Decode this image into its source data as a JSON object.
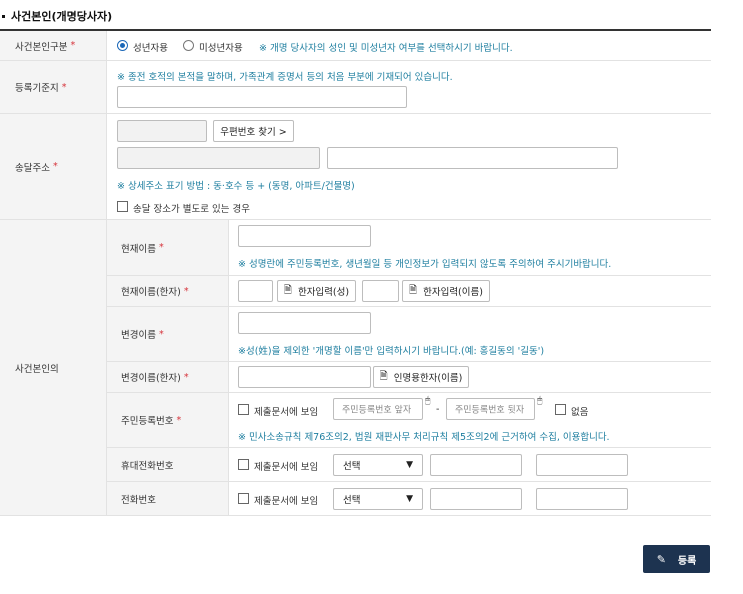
{
  "section": {
    "title": "사건본인(개명당사자)"
  },
  "required_mark": "*",
  "labels": {
    "category": "사건본인구분",
    "registry": "등록기준지",
    "address": "송달주소",
    "person": "사건본인의",
    "current_name": "현재이름",
    "current_name_hanja": "현재이름(한자)",
    "new_name": "변경이름",
    "new_name_hanja": "변경이름(한자)",
    "rrn": "주민등록번호",
    "mobile": "휴대전화번호",
    "phone": "전화번호"
  },
  "category": {
    "adult": "성년자용",
    "minor": "미성년자용",
    "selected": "adult",
    "note": "※ 개명 당사자의 성인 및 미성년자 여부를 선택하시기 바랍니다."
  },
  "registry": {
    "note": "※ 종전 호적의 본적을 말하며, 가족관계 증명서 등의 처음 부분에 기재되어 있습니다."
  },
  "address": {
    "zip_button": "우편번호 찾기 >",
    "note": "※ 상세주소 표기 방법 : 동·호수 등 + (동명, 아파트/건물명)",
    "separate_label": "송달 장소가 별도로 있는 경우"
  },
  "current_name": {
    "note": "※ 성명란에 주민등록번호, 생년월일 등 개인정보가 입력되지 않도록 주의하여 주시기바랍니다."
  },
  "current_name_hanja": {
    "surname_button": "한자입력(성)",
    "given_button": "한자입력(이름)"
  },
  "new_name": {
    "note": "※성(姓)을 제외한 '개명할 이름'만 입력하시기 바랍니다.(예: 홍길동의 '길동')"
  },
  "new_name_hanja": {
    "button": "인명용한자(이름)"
  },
  "rrn": {
    "include_label": "제출문서에 보임",
    "front_placeholder": "주민등록번호 앞자",
    "dash": "-",
    "back_placeholder": "주민등록번호 뒷자",
    "none_label": "없음",
    "note": "※ 민사소송규칙 제76조의2, 법원 재판사무 처리규칙 제5조의2에 근거하여 수집, 이용합니다."
  },
  "mobile": {
    "include_label": "제출문서에 보임",
    "select_value": "선택"
  },
  "phone": {
    "include_label": "제출문서에 보임",
    "select_value": "선택"
  },
  "submit": {
    "label": "등록"
  },
  "colors": {
    "accent": "#1f7fa0",
    "required": "#d6323a",
    "button_dark": "#1d3350",
    "radio": "#1a67b8"
  }
}
